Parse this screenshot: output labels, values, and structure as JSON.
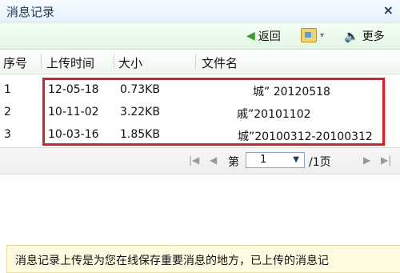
{
  "window": {
    "title": "消息记录",
    "close_icon": "×"
  },
  "toolbar": {
    "back_label": "返回",
    "more_label": "更多"
  },
  "table": {
    "headers": [
      "序号",
      "上传时间",
      "大小",
      "文件名"
    ],
    "rows": [
      {
        "index": "1",
        "date": "12-05-18",
        "size": "0.73KB",
        "name": "城” 20120518"
      },
      {
        "index": "2",
        "date": "10-11-02",
        "size": "3.22KB",
        "name": "戚”20101102"
      },
      {
        "index": "3",
        "date": "10-03-16",
        "size": "1.85KB",
        "name": "城”20100312-20100312"
      }
    ]
  },
  "pager": {
    "prefix": "第",
    "page": "1",
    "suffix": "/1页"
  },
  "notice": {
    "text": "消息记录上传是为您在线保存重要消息的地方，已上传的消息记"
  },
  "colors": {
    "highlight": "#e01b24",
    "toolbar_bg": "#e4f6e4",
    "title_bg": "#e6f1fb"
  }
}
